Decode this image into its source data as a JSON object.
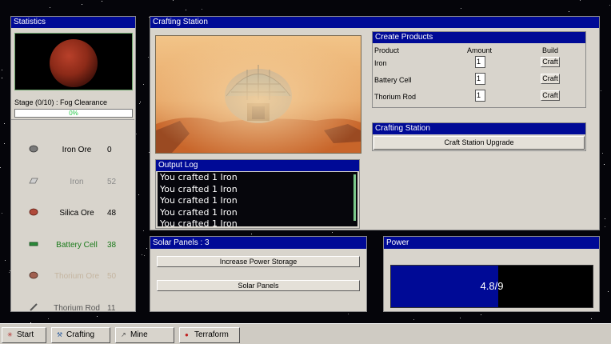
{
  "statistics": {
    "title": "Statistics",
    "stage_text": "Stage (0/10) : Fog Clearance",
    "progress_text": "0%",
    "progress": 0,
    "resources": [
      {
        "name": "Iron Ore",
        "value": "0",
        "icon": "ore-icon",
        "dim": false,
        "color": "#000000"
      },
      {
        "name": "Iron",
        "value": "52",
        "icon": "ingot-icon",
        "dim": true,
        "color": "#8a8a8a"
      },
      {
        "name": "Silica Ore",
        "value": "48",
        "icon": "silica-icon",
        "dim": false,
        "color": "#000000"
      },
      {
        "name": "Battery Cell",
        "value": "38",
        "icon": "battery-icon",
        "dim": false,
        "color": "#1a7a1a"
      },
      {
        "name": "Thorium Ore",
        "value": "50",
        "icon": "thorium-ore-icon",
        "dim": true,
        "color": "#c4b5a0"
      },
      {
        "name": "Thorium Rod",
        "value": "11",
        "icon": "rod-icon",
        "dim": false,
        "color": "#555555"
      }
    ]
  },
  "crafting_station": {
    "title": "Crafting Station"
  },
  "create_products": {
    "title": "Create Products",
    "headers": {
      "product": "Product",
      "amount": "Amount",
      "build": "Build"
    },
    "rows": [
      {
        "product": "Iron",
        "amount": "1",
        "build_label": "Craft"
      },
      {
        "product": "Battery Cell",
        "amount": "1",
        "build_label": "Craft"
      },
      {
        "product": "Thorium Rod",
        "amount": "1",
        "build_label": "Craft"
      }
    ]
  },
  "station_upgrade": {
    "title": "Crafting Station",
    "button_label": "Craft Station Upgrade"
  },
  "output_log": {
    "title": "Output Log",
    "lines": [
      "You crafted 1 Iron",
      "You crafted 1 Iron",
      "You crafted 1 Iron",
      "You crafted 1 Iron",
      "You crafted 1 Iron"
    ]
  },
  "solar": {
    "title": "Solar Panels : 3",
    "increase_label": "Increase Power Storage",
    "panels_label": "Solar Panels"
  },
  "power": {
    "title": "Power",
    "text": "4.8/9",
    "current": 4.8,
    "max": 9
  },
  "taskbar": {
    "items": [
      {
        "label": "Start",
        "icon": "start-icon"
      },
      {
        "label": "Crafting",
        "icon": "crafting-icon"
      },
      {
        "label": "Mine",
        "icon": "mine-icon"
      },
      {
        "label": "Terraform",
        "icon": "terraform-icon"
      }
    ]
  },
  "colors": {
    "titlebar": "#000a96",
    "panel": "#d8d4cc",
    "progress_fill": "#27c94a",
    "power_fill": "#000a96",
    "planet": "#8c2a18"
  }
}
